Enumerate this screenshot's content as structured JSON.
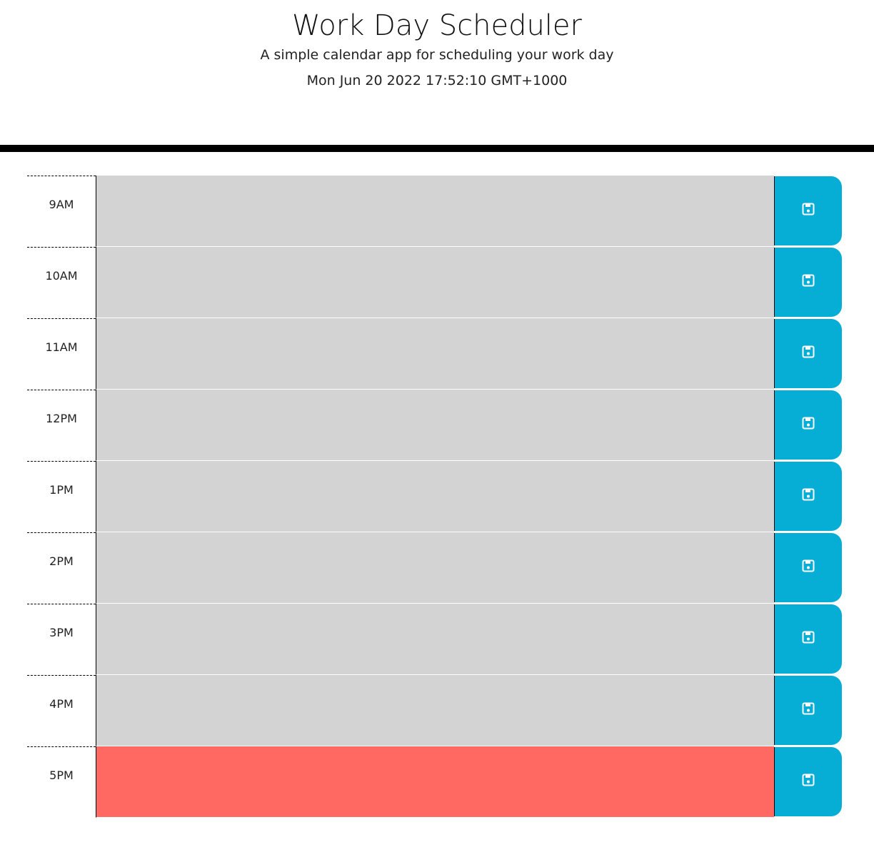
{
  "header": {
    "title": "Work Day Scheduler",
    "subtitle": "A simple calendar app for scheduling your work day",
    "current_datetime": "Mon Jun 20 2022 17:52:10 GMT+1000"
  },
  "colors": {
    "past": "#d3d3d3",
    "present": "#ff6961",
    "save_button": "#06aed5"
  },
  "timeblocks": [
    {
      "hour": "9AM",
      "status": "past",
      "text": ""
    },
    {
      "hour": "10AM",
      "status": "past",
      "text": ""
    },
    {
      "hour": "11AM",
      "status": "past",
      "text": ""
    },
    {
      "hour": "12PM",
      "status": "past",
      "text": ""
    },
    {
      "hour": "1PM",
      "status": "past",
      "text": ""
    },
    {
      "hour": "2PM",
      "status": "past",
      "text": ""
    },
    {
      "hour": "3PM",
      "status": "past",
      "text": ""
    },
    {
      "hour": "4PM",
      "status": "past",
      "text": ""
    },
    {
      "hour": "5PM",
      "status": "present",
      "text": ""
    }
  ],
  "icons": {
    "save": "floppy-disk-icon"
  }
}
